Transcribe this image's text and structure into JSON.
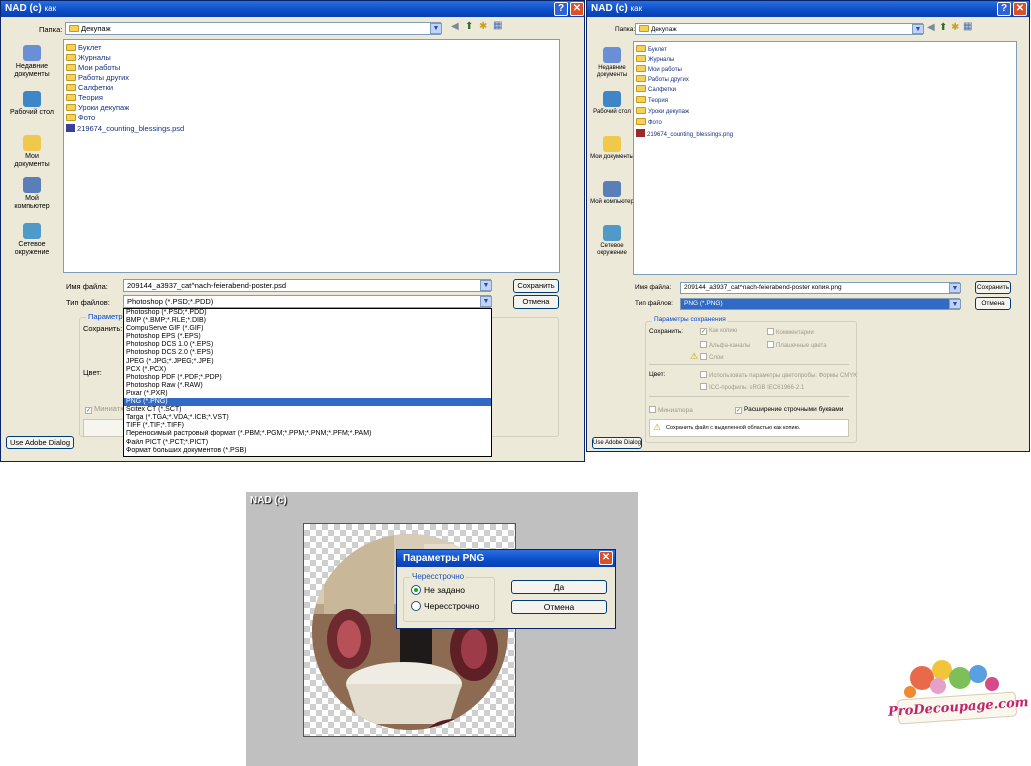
{
  "left_dialog": {
    "title": "NAD (c)",
    "title_suffix": "как",
    "folder_label": "Папка:",
    "folder_value": "Декупаж",
    "places": [
      "Недавние документы",
      "Рабочий стол",
      "Мои документы",
      "Мой компьютер",
      "Сетевое окружение"
    ],
    "folders": [
      "Буклет",
      "Журналы",
      "Мои работы",
      "Работы других",
      "Салфетки",
      "Теория",
      "Уроки декупаж",
      "Фото"
    ],
    "file": "219674_counting_blessings.psd",
    "filename_label": "Имя файла:",
    "filename_value": "209144_a3937_cat^nach-feierabend-poster.psd",
    "filetype_label": "Тип файлов:",
    "filetype_value": "Photoshop (*.PSD;*.PDD)",
    "save_button": "Сохранить",
    "cancel_button": "Отмена",
    "options_group": "Параметры",
    "save_label": "Сохранить:",
    "color_label": "Цвет:",
    "thumbnail_label": "Миниатюр",
    "adobe_button": "Use Adobe Dialog",
    "format_options": [
      "Photoshop (*.PSD;*.PDD)",
      "BMP (*.BMP;*.RLE;*.DIB)",
      "CompuServe GIF (*.GIF)",
      "Photoshop EPS (*.EPS)",
      "Photoshop DCS 1.0 (*.EPS)",
      "Photoshop DCS 2.0 (*.EPS)",
      "JPEG (*.JPG;*.JPEG;*.JPE)",
      "PCX (*.PCX)",
      "Photoshop PDF (*.PDF;*.PDP)",
      "Photoshop Raw (*.RAW)",
      "Pixar (*.PXR)",
      "PNG (*.PNG)",
      "Scitex CT (*.SCT)",
      "Targa (*.TGA;*.VDA;*.ICB;*.VST)",
      "TIFF (*.TIF;*.TIFF)",
      "Переносимый растровый формат (*.PBM;*.PGM;*.PPM;*.PNM;*.PFM;*.PAM)",
      "Файл PICT (*.PCT;*.PICT)",
      "Формат больших документов (*.PSB)"
    ],
    "selected_format_index": 11
  },
  "right_dialog": {
    "title": "NAD (c)",
    "title_suffix": "как",
    "folder_label": "Папка:",
    "folder_value": "Декупаж",
    "places": [
      "Недавние документы",
      "Рабочий стол",
      "Мои документы",
      "Мой компьютер",
      "Сетевое окружение"
    ],
    "folders": [
      "Буклет",
      "Журналы",
      "Мои работы",
      "Работы других",
      "Салфетки",
      "Теория",
      "Уроки декупаж",
      "Фото"
    ],
    "file": "219674_counting_blessings.png",
    "filename_label": "Имя файла:",
    "filename_value": "209144_a3937_cat^nach-feierabend-poster копия.png",
    "filetype_label": "Тип файлов:",
    "filetype_value": "PNG (*.PNG)",
    "save_button": "Сохранить",
    "cancel_button": "Отмена",
    "options_group": "Параметры сохранения",
    "save_label": "Сохранить:",
    "opt_copy": "Как копию",
    "opt_comments": "Комментарии",
    "opt_alpha": "Альфа-каналы",
    "opt_spot": "Плашечные цвета",
    "opt_layers": "Слои",
    "color_label": "Цвет:",
    "opt_proof": "Использовать параметры цветопробы: Формы CMYK",
    "opt_icc": "ICC-профиль: sRGB IEC61966-2.1",
    "thumbnail_label": "Миниатюра",
    "lowercase_label": "Расширение строчными буквами",
    "warning_text": "Сохранить файл с выделенной областью как копию.",
    "adobe_button": "Use Adobe Dialog"
  },
  "png_options": {
    "canvas_title": "NAD (c)",
    "dialog_title": "Параметры PNG",
    "group_label": "Чересстрочно",
    "option_none": "Не задано",
    "option_interlaced": "Чересстрочно",
    "ok_button": "Да",
    "cancel_button": "Отмена"
  },
  "logo": {
    "text": "ProDecoupage.com"
  }
}
